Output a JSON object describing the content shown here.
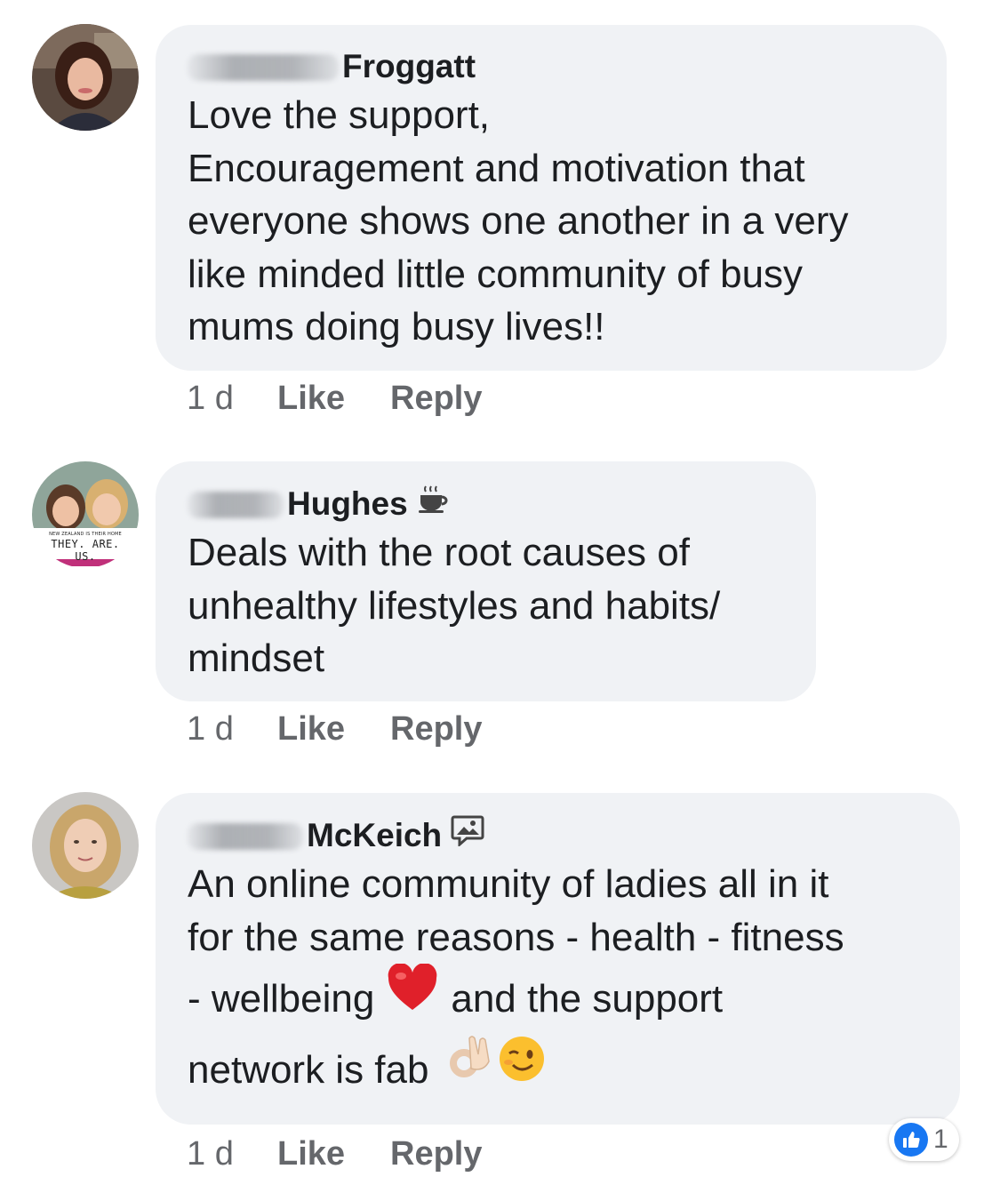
{
  "comments": [
    {
      "author_visible": "Froggatt",
      "text_lines": [
        "Love the support,",
        "Encouragement and motivation that",
        "everyone shows one another in a very",
        "like minded little community of busy",
        "mums doing busy lives!!"
      ],
      "time": "1 d",
      "like_label": "Like",
      "reply_label": "Reply",
      "avatar_icon": "profile-photo-woman-dark-hair"
    },
    {
      "author_visible": "Hughes",
      "badge_icon": "coffee-cup-icon",
      "text_lines": [
        "Deals with the root causes of",
        "unhealthy lifestyles and habits/",
        "mindset"
      ],
      "time": "1 d",
      "like_label": "Like",
      "reply_label": "Reply",
      "avatar_icon": "profile-photo-two-girls",
      "avatar_caption_small": "NEW ZEALAND IS THEIR HOME",
      "avatar_caption": "THEY. ARE. US."
    },
    {
      "author_visible": "McKeich",
      "badge_icon": "picture-comment-icon",
      "text_lines": [
        "An online community of ladies all in it",
        "for the same reasons - health - fitness",
        "- wellbeing",
        "and the support",
        "network is fab"
      ],
      "emojis": [
        "red-heart-emoji",
        "ok-hand-emoji",
        "winking-face-emoji"
      ],
      "time": "1 d",
      "like_label": "Like",
      "reply_label": "Reply",
      "avatar_icon": "profile-photo-woman-blonde",
      "reaction_count": "1"
    }
  ],
  "colors": {
    "bubble": "#f0f2f5",
    "meta_text": "#65676b",
    "like_blue": "#1877f2"
  }
}
